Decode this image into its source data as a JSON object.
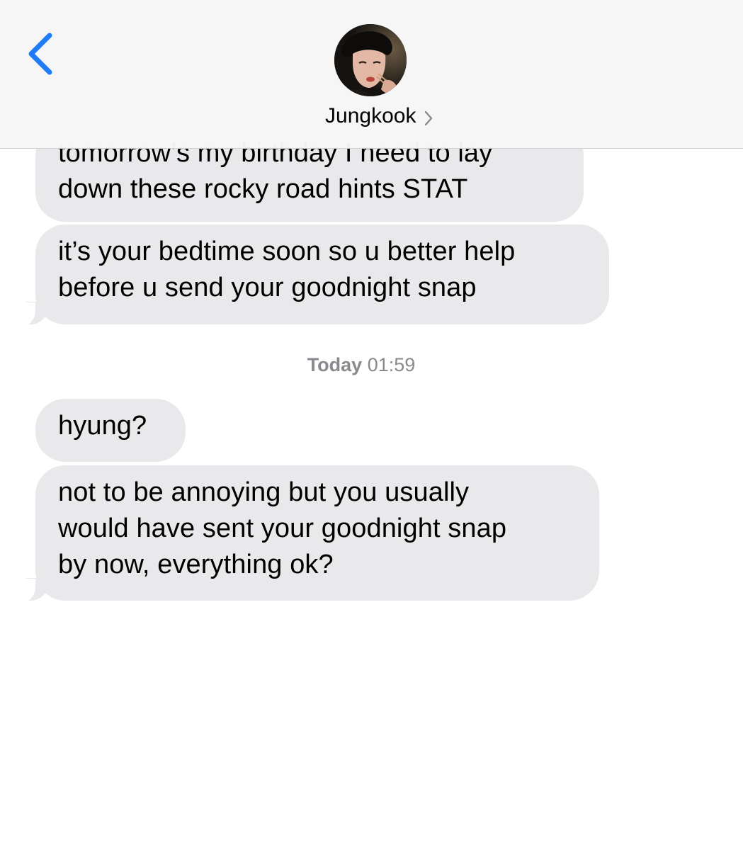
{
  "header": {
    "back_icon": "chevron-left-icon",
    "contact_name": "Jungkook",
    "contact_chevron_icon": "chevron-right-icon",
    "avatar_icon": "contact-photo"
  },
  "messages": [
    {
      "text": "tomorrow’s my birthday I need to lay\ndown these rocky road hints STAT"
    },
    {
      "text": "it’s your bedtime soon so u better help\nbefore u send your goodnight snap"
    },
    {
      "text": "hyung?"
    },
    {
      "text": "not to be annoying but you usually\nwould have sent your goodnight snap\nby now, everything ok?"
    }
  ],
  "timestamp": {
    "day": "Today",
    "time": "01:59"
  },
  "colors": {
    "accent": "#1f7cf6",
    "incoming_bubble": "#e9e9eb",
    "timestamp_text": "#8a8a8e",
    "header_bg": "#f6f6f6"
  }
}
